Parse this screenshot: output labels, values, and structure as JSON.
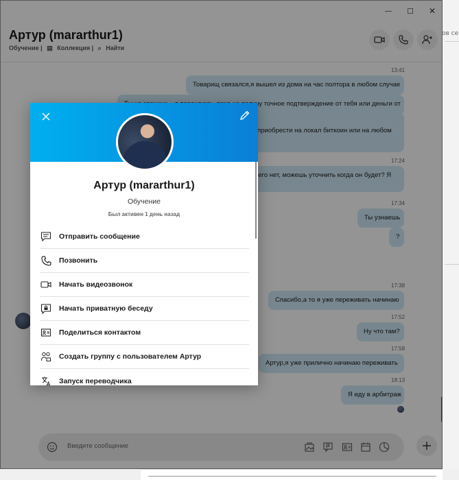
{
  "window": {
    "minimize": "—",
    "maximize": "☐",
    "close": "✕"
  },
  "desktop": {
    "side_text": "ов се..."
  },
  "header": {
    "title": "Артур (mararthur1)",
    "sub": [
      "Обучение |",
      "Коллекция |",
      "Найти"
    ]
  },
  "messages": [
    {
      "time": "13:41",
      "text": "Товарищ связался,я вышел из дома на час полтора в любом случае"
    },
    {
      "time": "",
      "text": "Ты не звонишь , я параноюсь, пока не получу точное подтверждение от тебя или деньги от"
    },
    {
      "time": "",
      "text": "приобрести на локал биткоин или на любом"
    },
    {
      "time": "17:24",
      "text": ", его нет, можешь уточнить когда он будет? Я"
    },
    {
      "time": "17:34",
      "text": "Ты узнаешь"
    },
    {
      "time": "",
      "text": "?"
    },
    {
      "time": "17:38",
      "text": "Спасибо,а то я уже переживать начинаю"
    },
    {
      "time": "17:52",
      "text": "Ну что там?"
    },
    {
      "time": "17:58",
      "text": "Артур,я уже прилично начинаю переживать"
    },
    {
      "time": "18:13",
      "text": "Я иду в арбитраж"
    }
  ],
  "composer": {
    "placeholder": "Введите сообщение"
  },
  "profile": {
    "name": "Артур (mararthur1)",
    "role": "Обучение",
    "last_active": "Был активен 1 день назад",
    "actions": [
      {
        "icon": "message-icon",
        "label": "Отправить сообщение"
      },
      {
        "icon": "phone-icon",
        "label": "Позвонить"
      },
      {
        "icon": "video-icon",
        "label": "Начать видеозвонок"
      },
      {
        "icon": "lock-chat-icon",
        "label": "Начать приватную беседу"
      },
      {
        "icon": "contact-card-icon",
        "label": "Поделиться контактом"
      },
      {
        "icon": "group-add-icon",
        "label": "Создать группу с пользователем Артур"
      },
      {
        "icon": "translate-icon",
        "label": "Запуск переводчика"
      }
    ]
  },
  "colors": {
    "accent": "#00aff0",
    "bubble": "#cfe8f7",
    "hero_end": "#0a7fd6"
  }
}
